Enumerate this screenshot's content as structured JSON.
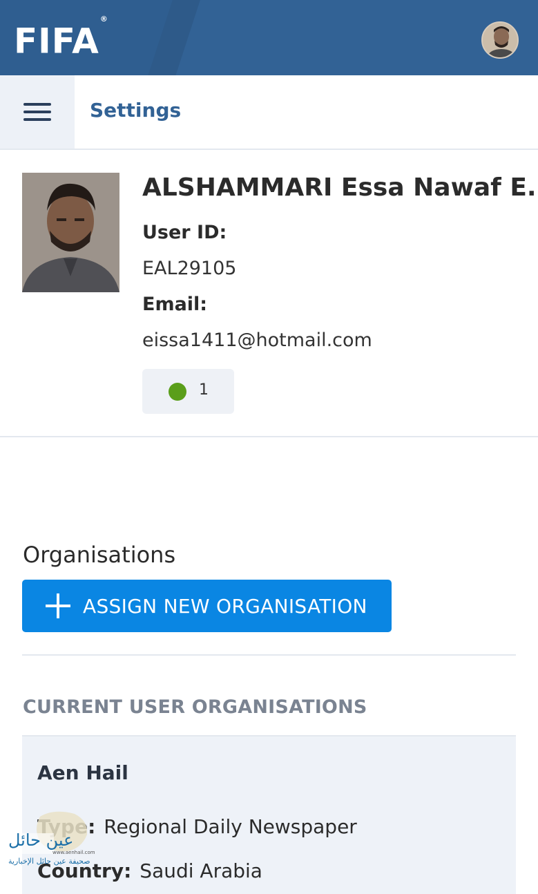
{
  "header": {
    "logo_text": "FIFA",
    "logo_mark": "®",
    "brand_color": "#326295"
  },
  "settings_bar": {
    "menu_icon": "hamburger-menu-icon",
    "title": "Settings"
  },
  "profile": {
    "name": "ALSHAMMARI Essa Nawaf E.",
    "user_id_label": "User ID:",
    "user_id": "EAL29105",
    "email_label": "Email:",
    "email": "eissa1411@hotmail.com",
    "status_count": "1",
    "status_color": "#5a9e1a"
  },
  "organisations": {
    "heading": "Organisations",
    "assign_button": "ASSIGN NEW ORGANISATION",
    "assign_button_color": "#0a86e3",
    "current_heading": "CURRENT USER ORGANISATIONS",
    "items": [
      {
        "name": "Aen Hail",
        "type_label": "Type:",
        "type": "Regional Daily Newspaper",
        "country_label": "Country:",
        "country": "Saudi Arabia"
      }
    ]
  },
  "watermark": {
    "text_ar": "عين حائل",
    "url": "www.aenhail.com",
    "sub_ar": "صحيفة عين حائل الإخبارية"
  }
}
